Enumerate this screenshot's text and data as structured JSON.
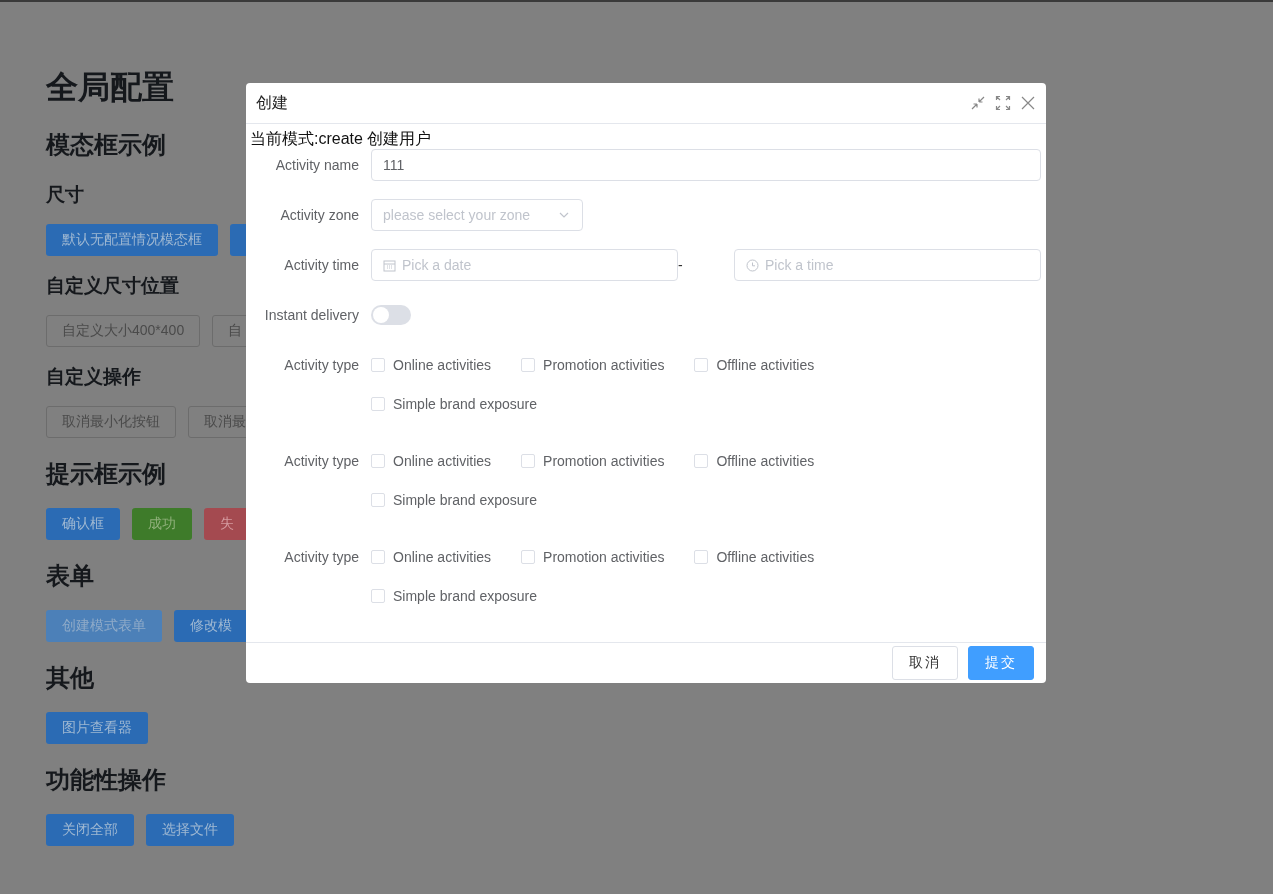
{
  "page": {
    "title": "全局配置",
    "blocks": [
      {
        "kind": "heading",
        "text": "模态框示例"
      },
      {
        "kind": "subheading",
        "text": "尺寸"
      },
      {
        "kind": "buttons",
        "buttons": [
          {
            "label": "默认无配置情况模态框",
            "kind": "primary"
          },
          {
            "kind": "primary"
          }
        ]
      },
      {
        "kind": "subheading",
        "text": "自定义尺寸位置"
      },
      {
        "kind": "buttons",
        "buttons": [
          {
            "label": "自定义大小400*400",
            "kind": "default"
          },
          {
            "label": "自",
            "kind": "default"
          }
        ]
      },
      {
        "kind": "subheading",
        "text": "自定义操作"
      },
      {
        "kind": "buttons",
        "buttons": [
          {
            "label": "取消最小化按钮",
            "kind": "default"
          },
          {
            "label": "取消最",
            "kind": "default"
          }
        ]
      },
      {
        "kind": "heading",
        "text": "提示框示例"
      },
      {
        "kind": "buttons",
        "buttons": [
          {
            "label": "确认框",
            "kind": "primary"
          },
          {
            "label": "成功",
            "kind": "success"
          },
          {
            "label": "失",
            "kind": "danger"
          }
        ]
      },
      {
        "kind": "heading",
        "text": "表单"
      },
      {
        "kind": "buttons",
        "buttons": [
          {
            "label": "创建模式表单",
            "kind": "light"
          },
          {
            "label": "修改模",
            "kind": "primary"
          }
        ]
      },
      {
        "kind": "heading",
        "text": "其他"
      },
      {
        "kind": "buttons",
        "buttons": [
          {
            "label": "图片查看器",
            "kind": "primary"
          }
        ]
      },
      {
        "kind": "heading",
        "text": "功能性操作"
      },
      {
        "kind": "buttons",
        "buttons": [
          {
            "label": "关闭全部",
            "kind": "primary"
          },
          {
            "label": "选择文件",
            "kind": "primary"
          }
        ]
      }
    ]
  },
  "dialog": {
    "title": "创建",
    "mode_text": "当前模式:create 创建用户",
    "fields": [
      {
        "kind": "input",
        "label": "Activity name",
        "value": "111"
      },
      {
        "kind": "select",
        "label": "Activity zone",
        "placeholder": "please select your zone"
      },
      {
        "kind": "range",
        "label": "Activity time",
        "start_placeholder": "Pick a date",
        "separator": "-",
        "end_placeholder": "Pick a time"
      },
      {
        "kind": "switch",
        "label": "Instant delivery",
        "on": false
      },
      {
        "kind": "checkboxes",
        "label": "Activity type",
        "options": [
          {
            "label": "Online activities",
            "checked": false
          },
          {
            "label": "Promotion activities",
            "checked": false
          },
          {
            "label": "Offline activities",
            "checked": false
          },
          {
            "label": "Simple brand exposure",
            "checked": false
          }
        ]
      },
      {
        "kind": "checkboxes",
        "label": "Activity type",
        "options": [
          {
            "label": "Online activities",
            "checked": false
          },
          {
            "label": "Promotion activities",
            "checked": false
          },
          {
            "label": "Offline activities",
            "checked": false
          },
          {
            "label": "Simple brand exposure",
            "checked": false
          }
        ]
      },
      {
        "kind": "checkboxes",
        "label": "Activity type",
        "options": [
          {
            "label": "Online activities",
            "checked": false
          },
          {
            "label": "Promotion activities",
            "checked": false
          },
          {
            "label": "Offline activities",
            "checked": false
          },
          {
            "label": "Simple brand exposure",
            "checked": false
          }
        ]
      }
    ],
    "buttons": [
      {
        "label": "取消",
        "kind": "default"
      },
      {
        "label": "提交",
        "kind": "primary"
      }
    ]
  }
}
